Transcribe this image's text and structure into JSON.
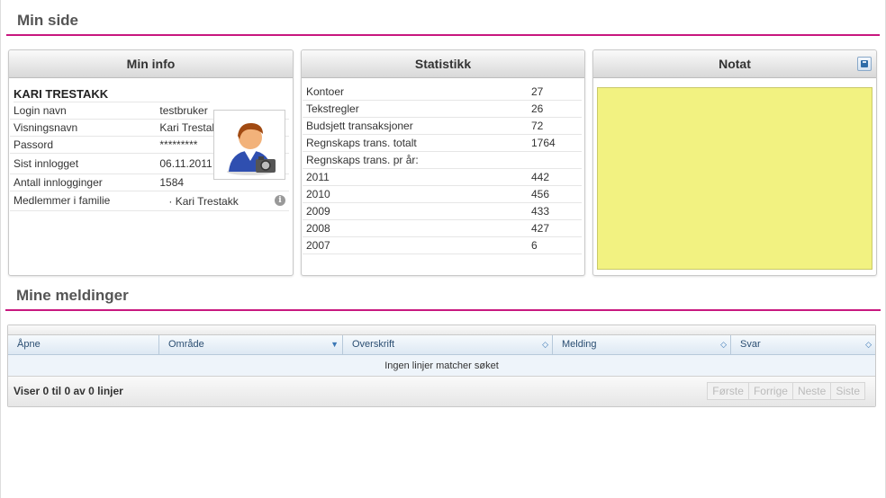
{
  "page": {
    "title": "Min side"
  },
  "min_info": {
    "title": "Min info",
    "name": "KARI TRESTAKK",
    "rows": [
      {
        "label": "Login navn",
        "value": "testbruker"
      },
      {
        "label": "Visningsnavn",
        "value": "Kari Trestakk"
      },
      {
        "label": "Passord",
        "value": "*********"
      },
      {
        "label": "Sist innlogget",
        "value": "06.11.2011 20:41:07"
      },
      {
        "label": "Antall innlogginger",
        "value": "1584"
      },
      {
        "label": "Medlemmer i familie",
        "value": "· Kari Trestakk"
      }
    ],
    "avatar_icon": "user-photographer-icon"
  },
  "statistikk": {
    "title": "Statistikk",
    "rows": [
      {
        "label": "Kontoer",
        "value": "27"
      },
      {
        "label": "Tekstregler",
        "value": "26"
      },
      {
        "label": "Budsjett transaksjoner",
        "value": "72"
      },
      {
        "label": "Regnskaps trans. totalt",
        "value": "1764"
      },
      {
        "label": "Regnskaps trans. pr år:",
        "value": ""
      },
      {
        "label": "2011",
        "value": "442"
      },
      {
        "label": "2010",
        "value": "456"
      },
      {
        "label": "2009",
        "value": "433"
      },
      {
        "label": "2008",
        "value": "427"
      },
      {
        "label": "2007",
        "value": "6"
      }
    ]
  },
  "notat": {
    "title": "Notat",
    "text": ""
  },
  "mine_meldinger": {
    "title": "Mine meldinger",
    "columns": [
      "Åpne",
      "Område",
      "Overskrift",
      "Melding",
      "Svar"
    ],
    "empty_text": "Ingen linjer matcher søket",
    "summary": "Viser 0 til 0 av 0 linjer",
    "pager": {
      "first": "Første",
      "prev": "Forrige",
      "next": "Neste",
      "last": "Siste"
    }
  },
  "colors": {
    "accent": "#c8187f",
    "note_bg": "#f2f281"
  }
}
